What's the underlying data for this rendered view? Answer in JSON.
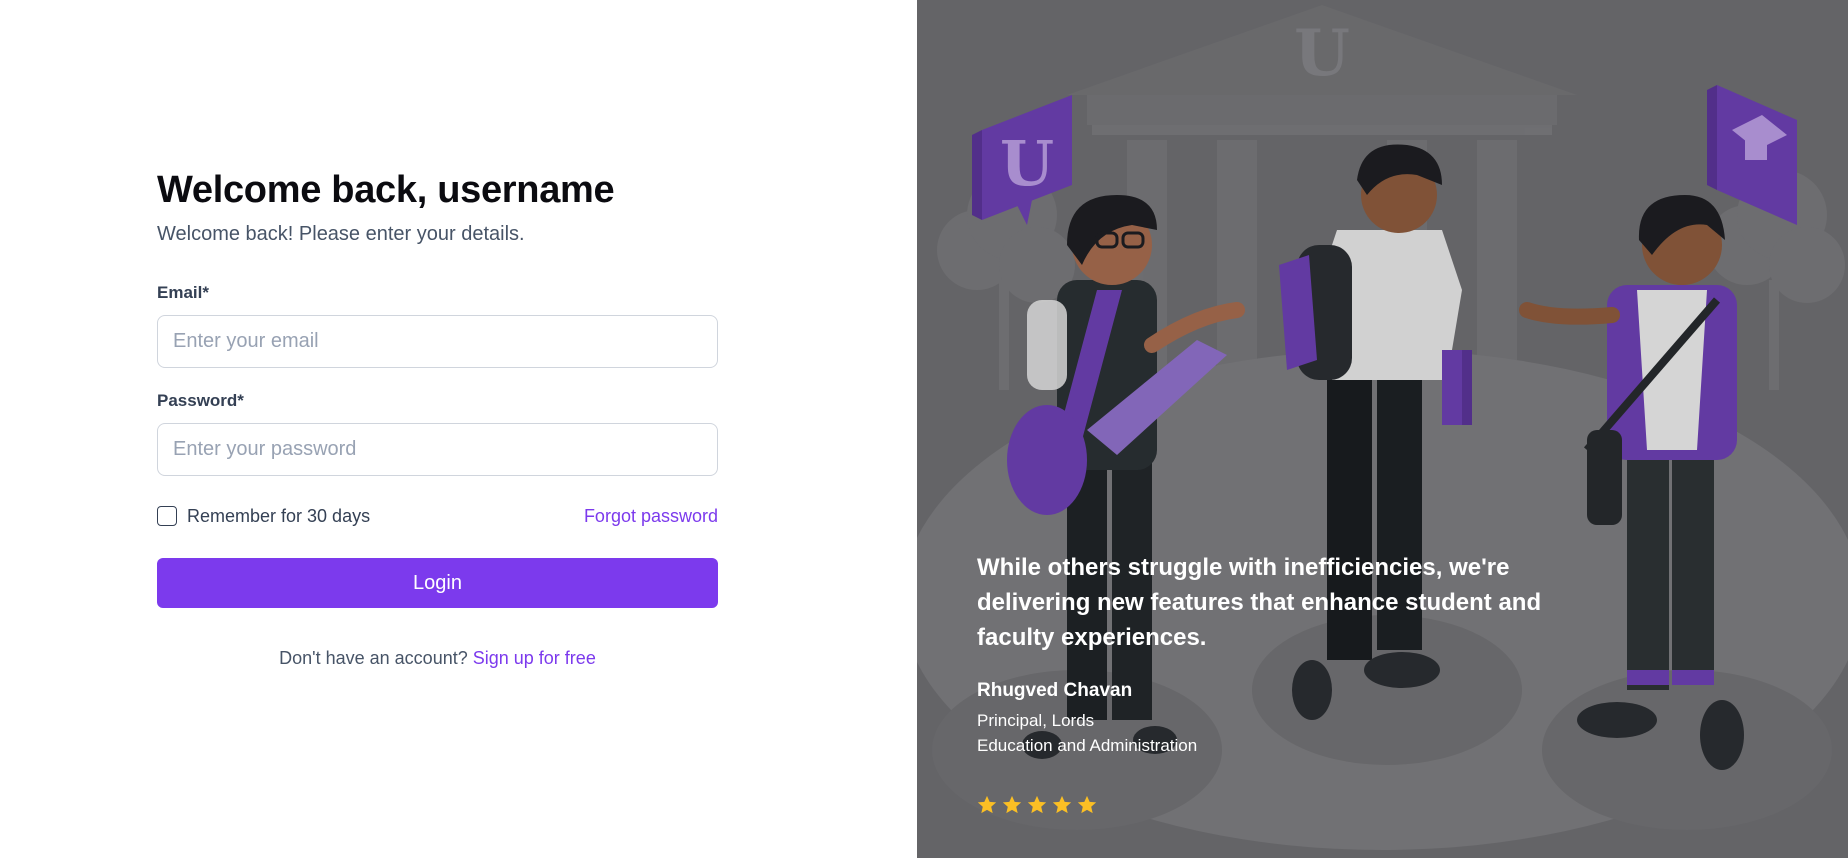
{
  "form": {
    "title": "Welcome back, username",
    "subtitle": "Welcome back! Please enter your details.",
    "email_label": "Email*",
    "email_placeholder": "Enter your email",
    "email_value": "",
    "password_label": "Password*",
    "password_placeholder": "Enter your password",
    "password_value": "",
    "remember_label": "Remember for 30 days",
    "remember_checked": false,
    "forgot_label": "Forgot password",
    "login_label": "Login",
    "signup_prompt": "Don't have an account?",
    "signup_link": "Sign up for free"
  },
  "testimonial": {
    "quote": "While others struggle with inefficiencies, we're delivering new features that enhance student and faculty experiences.",
    "author": "Rhugved Chavan",
    "role_line1": "Principal, Lords",
    "role_line2": "Education and Administration",
    "rating": 5,
    "rating_max": 5,
    "star_color": "#fbbf24"
  },
  "illustration": {
    "building_emblem": "U",
    "left_sign_letter": "U",
    "right_sign_icon": "graduation-cap-icon"
  },
  "colors": {
    "accent": "#7c3aed",
    "overlay": "#6d6d70",
    "text_primary": "#101828",
    "text_muted": "#475467"
  }
}
